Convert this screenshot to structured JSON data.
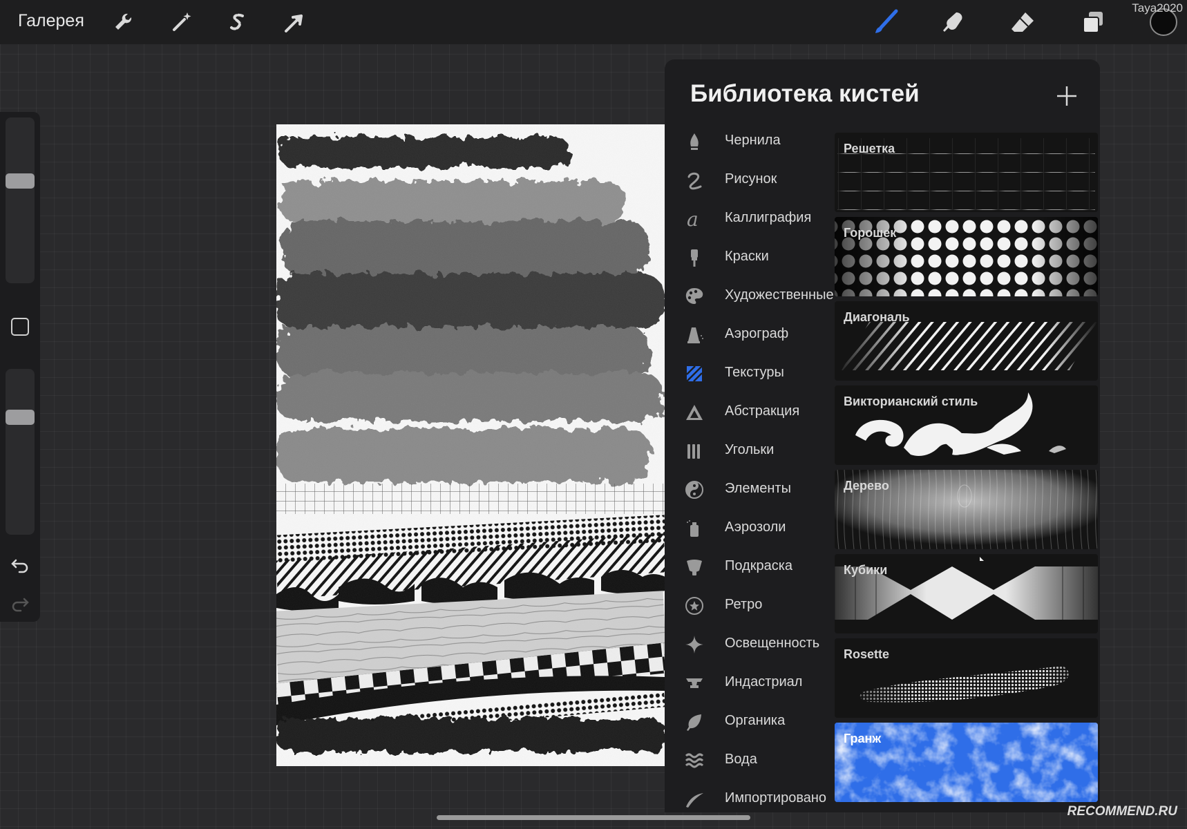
{
  "toolbar": {
    "gallery_label": "Галерея",
    "left_icons": [
      "wrench-icon",
      "magic-wand-icon",
      "selection-s-icon",
      "arrow-transform-icon"
    ],
    "right_icons": [
      "brush-icon",
      "smudge-icon",
      "eraser-icon",
      "layers-icon"
    ],
    "active_tool": "brush-icon",
    "current_color": "#0b0b0b",
    "user_tag": "Taya2020"
  },
  "sidebar": {
    "size_slider_level": 0.37,
    "opacity_slider_level": 0.27,
    "icons": [
      "modify-square-icon",
      "undo-icon",
      "redo-icon"
    ]
  },
  "brush_library": {
    "title": "Библиотека кистей",
    "add_icon": "plus-icon",
    "accent_color": "#2f6ee8",
    "categories": [
      {
        "label": "Чернила",
        "icon": "ink-drop-icon"
      },
      {
        "label": "Рисунок",
        "icon": "squiggle-icon"
      },
      {
        "label": "Каллиграфия",
        "icon": "calligraphy-a-icon"
      },
      {
        "label": "Краски",
        "icon": "paint-brush-icon"
      },
      {
        "label": "Художественные",
        "icon": "palette-icon"
      },
      {
        "label": "Аэрограф",
        "icon": "airbrush-icon"
      },
      {
        "label": "Текстуры",
        "icon": "texture-hatch-icon",
        "selected": true
      },
      {
        "label": "Абстракция",
        "icon": "triangle-icon"
      },
      {
        "label": "Угольки",
        "icon": "charcoal-sticks-icon"
      },
      {
        "label": "Элементы",
        "icon": "yin-yang-icon"
      },
      {
        "label": "Аэрозоли",
        "icon": "spray-can-icon"
      },
      {
        "label": "Подкраска",
        "icon": "cup-icon"
      },
      {
        "label": "Ретро",
        "icon": "star-circle-icon"
      },
      {
        "label": "Освещенность",
        "icon": "sparkle-icon"
      },
      {
        "label": "Индастриал",
        "icon": "anvil-icon"
      },
      {
        "label": "Органика",
        "icon": "leaf-icon"
      },
      {
        "label": "Вода",
        "icon": "waves-icon"
      },
      {
        "label": "Импортировано",
        "icon": "swoosh-icon"
      }
    ],
    "brushes": [
      {
        "name": "Решетка",
        "preview": "grid"
      },
      {
        "name": "Горошек",
        "preview": "dots"
      },
      {
        "name": "Диагональ",
        "preview": "diagonal"
      },
      {
        "name": "Викторианский стиль",
        "preview": "victorian"
      },
      {
        "name": "Дерево",
        "preview": "wood"
      },
      {
        "name": "Кубики",
        "preview": "cubes"
      },
      {
        "name": "Rosette",
        "preview": "rosette"
      },
      {
        "name": "Гранж",
        "preview": "grunge",
        "selected": true
      }
    ]
  },
  "watermark": "RECOMMEND.RU"
}
